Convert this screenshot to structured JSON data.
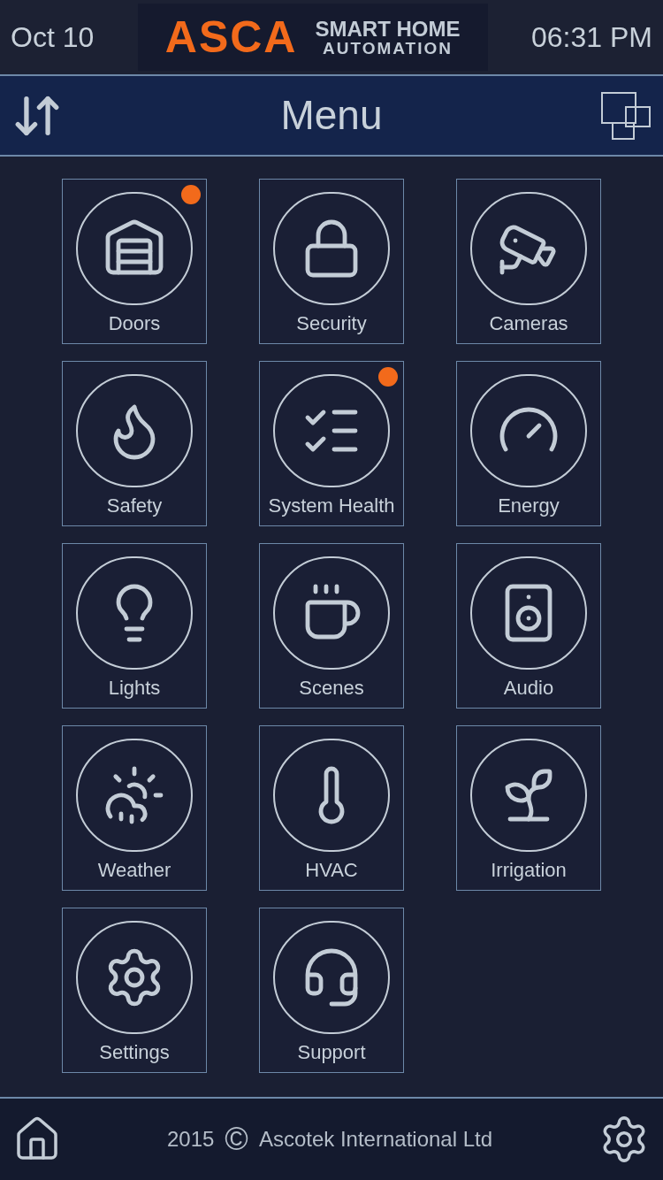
{
  "header": {
    "date": "Oct 10",
    "logo": {
      "brand": "ASCA",
      "tagline_top": "SMART HOME",
      "tagline_bottom": "AUTOMATION"
    },
    "time": "06:31 PM"
  },
  "title_bar": {
    "title": "Menu"
  },
  "tiles": [
    {
      "label": "Doors",
      "alert": true
    },
    {
      "label": "Security",
      "alert": false
    },
    {
      "label": "Cameras",
      "alert": false
    },
    {
      "label": "Safety",
      "alert": false
    },
    {
      "label": "System Health",
      "alert": true
    },
    {
      "label": "Energy",
      "alert": false
    },
    {
      "label": "Lights",
      "alert": false
    },
    {
      "label": "Scenes",
      "alert": false
    },
    {
      "label": "Audio",
      "alert": false
    },
    {
      "label": "Weather",
      "alert": false
    },
    {
      "label": "HVAC",
      "alert": false
    },
    {
      "label": "Irrigation",
      "alert": false
    },
    {
      "label": "Settings",
      "alert": false
    },
    {
      "label": "Support",
      "alert": false
    }
  ],
  "footer": {
    "year": "2015",
    "symbol": "©",
    "company": "Ascotek International Ltd"
  }
}
